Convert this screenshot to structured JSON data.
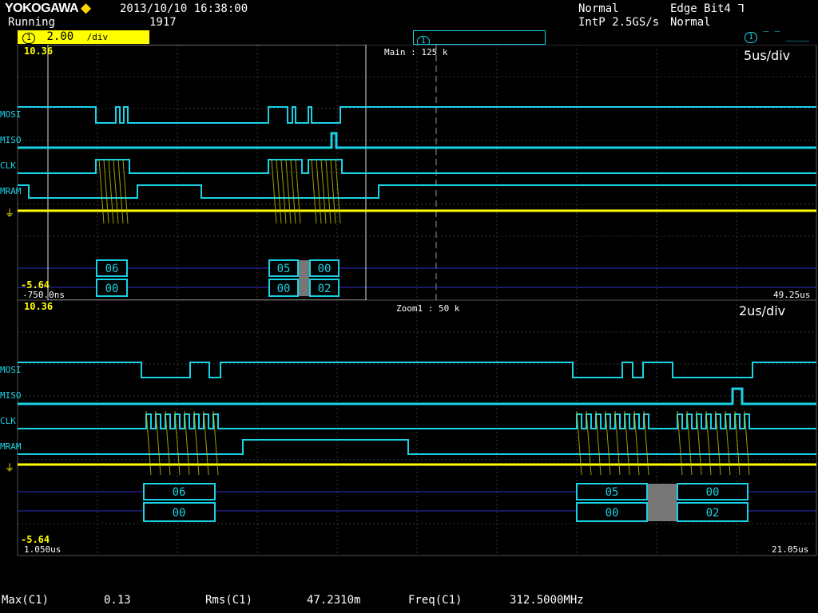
{
  "header": {
    "brand": "YOKOGAWA",
    "state": "Running",
    "datetime": "2013/10/10 16:38:00",
    "acq_count": "1917",
    "acq_mode": "Normal",
    "sample_rate": "IntP 2.5GS/s",
    "trigger_label": "Edge Bit4",
    "trigger_mode": "Normal"
  },
  "ch1_scale": "2.00",
  "ch1_scale_unit": "/div",
  "ch1_num": "1",
  "main": {
    "title": "Main : 125 k",
    "timebase": "5us/div",
    "top_level": "10.36",
    "bottom_level": "-5.64",
    "start_time": "-750.0ns",
    "end_time": "49.25us",
    "decode_a": [
      "06",
      "05",
      "00"
    ],
    "decode_b": [
      "00",
      "00",
      "02"
    ]
  },
  "zoom": {
    "title": "Zoom1 : 50 k",
    "timebase": "2us/div",
    "top_level": "10.36",
    "bottom_level": "-5.64",
    "start_time": "1.050us",
    "end_time": "21.05us",
    "decode_a": [
      "06",
      "05",
      "00"
    ],
    "decode_b": [
      "00",
      "00",
      "02"
    ]
  },
  "trace_labels": [
    "MOSI",
    "MISO",
    "CLK",
    "MRAM"
  ],
  "measurements": [
    {
      "name": "Max(C1)",
      "value": "0.13"
    },
    {
      "name": "Rms(C1)",
      "value": "47.2310m"
    },
    {
      "name": "Freq(C1)",
      "value": "312.5000MHz"
    }
  ],
  "colors": {
    "trace": "#19d2e6",
    "analog": "#ffff00",
    "grid": "#3a3a3a",
    "marker": "#3030c8"
  }
}
